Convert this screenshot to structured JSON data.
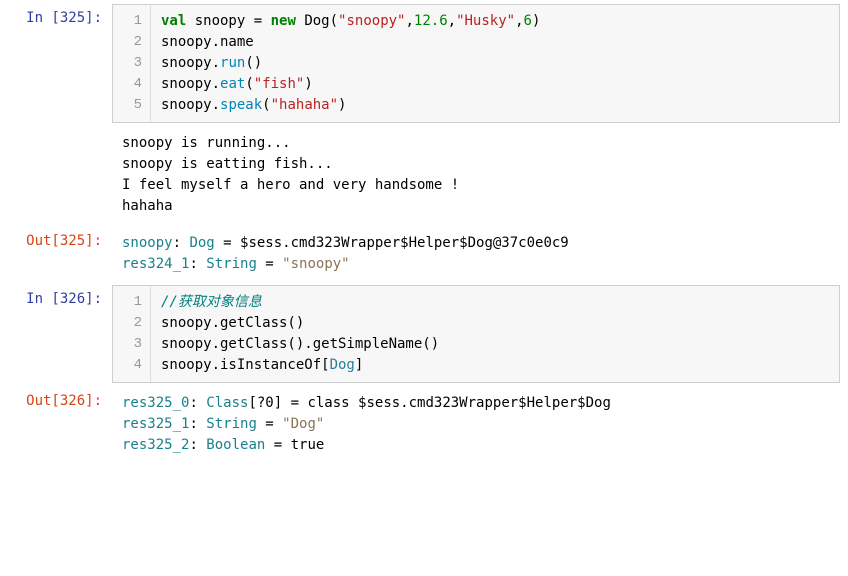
{
  "cells": [
    {
      "in_prompt": "In  [325]:",
      "gutter": [
        "1",
        "2",
        "3",
        "4",
        "5"
      ],
      "code_tokens": [
        [
          {
            "t": "val ",
            "c": "tk-kw"
          },
          {
            "t": "snoopy "
          },
          {
            "t": "= "
          },
          {
            "t": "new ",
            "c": "tk-kw"
          },
          {
            "t": "Dog"
          },
          {
            "t": "("
          },
          {
            "t": "\"snoopy\"",
            "c": "tk-str"
          },
          {
            "t": ","
          },
          {
            "t": "12.6",
            "c": "tk-num"
          },
          {
            "t": ","
          },
          {
            "t": "\"Husky\"",
            "c": "tk-str"
          },
          {
            "t": ","
          },
          {
            "t": "6",
            "c": "tk-num"
          },
          {
            "t": ")"
          }
        ],
        [
          {
            "t": "snoopy.name"
          }
        ],
        [
          {
            "t": "snoopy."
          },
          {
            "t": "run",
            "c": "tk-call"
          },
          {
            "t": "()"
          }
        ],
        [
          {
            "t": "snoopy."
          },
          {
            "t": "eat",
            "c": "tk-call"
          },
          {
            "t": "("
          },
          {
            "t": "\"fish\"",
            "c": "tk-str"
          },
          {
            "t": ")"
          }
        ],
        [
          {
            "t": "snoopy."
          },
          {
            "t": "speak",
            "c": "tk-call"
          },
          {
            "t": "("
          },
          {
            "t": "\"hahaha\"",
            "c": "tk-str"
          },
          {
            "t": ")"
          }
        ]
      ],
      "stdout": "snoopy is running...\nsnoopy is eatting fish...\nI feel myself a hero and very handsome !\nhahaha",
      "out_prompt": "Out[325]:",
      "out_tokens": [
        [
          {
            "t": "snoopy",
            "c": "tk-out-var"
          },
          {
            "t": ": "
          },
          {
            "t": "Dog",
            "c": "tk-out-type"
          },
          {
            "t": " = $sess.cmd323Wrapper$Helper$Dog@37c0e0c9"
          }
        ],
        [
          {
            "t": "res324_1",
            "c": "tk-out-var"
          },
          {
            "t": ": "
          },
          {
            "t": "String",
            "c": "tk-out-type"
          },
          {
            "t": " = "
          },
          {
            "t": "\"snoopy\"",
            "c": "tk-out-str"
          }
        ]
      ]
    },
    {
      "in_prompt": "In  [326]:",
      "gutter": [
        "1",
        "2",
        "3",
        "4"
      ],
      "code_tokens": [
        [
          {
            "t": "//获取对象信息",
            "c": "tk-comment"
          }
        ],
        [
          {
            "t": "snoopy.getClass()"
          }
        ],
        [
          {
            "t": "snoopy.getClass().getSimpleName()"
          }
        ],
        [
          {
            "t": "snoopy.isInstanceOf["
          },
          {
            "t": "Dog",
            "c": "tk-type"
          },
          {
            "t": "]"
          }
        ]
      ],
      "stdout": null,
      "out_prompt": "Out[326]:",
      "out_tokens": [
        [
          {
            "t": "res325_0",
            "c": "tk-out-var"
          },
          {
            "t": ": "
          },
          {
            "t": "Class",
            "c": "tk-out-type"
          },
          {
            "t": "[?0] = class $sess.cmd323Wrapper$Helper$Dog"
          }
        ],
        [
          {
            "t": "res325_1",
            "c": "tk-out-var"
          },
          {
            "t": ": "
          },
          {
            "t": "String",
            "c": "tk-out-type"
          },
          {
            "t": " = "
          },
          {
            "t": "\"Dog\"",
            "c": "tk-out-str"
          }
        ],
        [
          {
            "t": "res325_2",
            "c": "tk-out-var"
          },
          {
            "t": ": "
          },
          {
            "t": "Boolean",
            "c": "tk-out-type"
          },
          {
            "t": " = true"
          }
        ]
      ]
    }
  ]
}
